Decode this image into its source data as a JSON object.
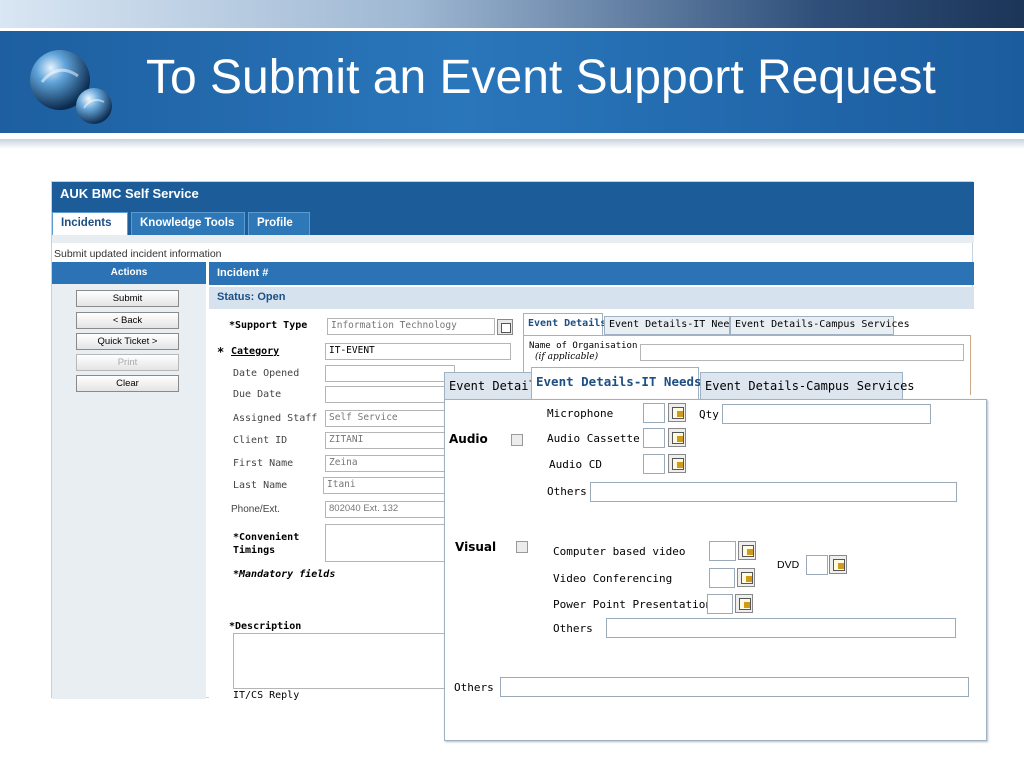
{
  "slide": {
    "title": "To Submit an Event Support Request"
  },
  "app": {
    "title": "AUK BMC Self Service",
    "tabs": [
      "Incidents",
      "Knowledge Tools",
      "Profile"
    ],
    "breadcrumb": "Submit updated incident information"
  },
  "sidebar": {
    "header": "Actions",
    "buttons": [
      "Submit",
      "< Back",
      "Quick Ticket >",
      "Print",
      "Clear"
    ]
  },
  "incident": {
    "header": "Incident #",
    "status": "Status: Open"
  },
  "form": {
    "support_type_label": "*Support Type",
    "support_type_value": "Information Technology",
    "category_star": "*",
    "category_label": "Category",
    "category_value": "IT-EVENT",
    "date_opened_label": "Date Opened",
    "due_date_label": "Due Date",
    "assigned_staff_label": "Assigned Staff",
    "assigned_staff_value": "Self Service",
    "client_id_label": "Client ID",
    "client_id_value": "ZITANI",
    "first_name_label": "First Name",
    "first_name_value": "Zeina",
    "last_name_label": "Last Name",
    "last_name_value": "Itani",
    "phone_label": "Phone/Ext.",
    "phone_value": "802040 Ext. 132",
    "timings_label": "*Convenient Timings",
    "mandatory_note": "*Mandatory fields",
    "description_label": "*Description",
    "reply_label": "IT/CS Reply"
  },
  "inner_tabs": {
    "tabs": [
      "Event Details",
      "Event Details-IT Needs",
      "Event Details-Campus Services"
    ],
    "org_label": "Name of Organisation",
    "org_sub": "(if applicable)"
  },
  "overlay": {
    "tabs": [
      "Event Details",
      "Event Details-IT Needs",
      "Event Details-Campus Services"
    ],
    "audio_label": "Audio",
    "visual_label": "Visual",
    "microphone": "Microphone",
    "qty": "Qty",
    "audio_cassette": "Audio Cassette",
    "audio_cd": "Audio CD",
    "audio_others": "Others",
    "computer_video": "Computer based video",
    "dvd": "DVD",
    "video_conf": "Video Conferencing",
    "powerpoint": "Power Point Presentation",
    "visual_others": "Others",
    "others": "Others"
  }
}
